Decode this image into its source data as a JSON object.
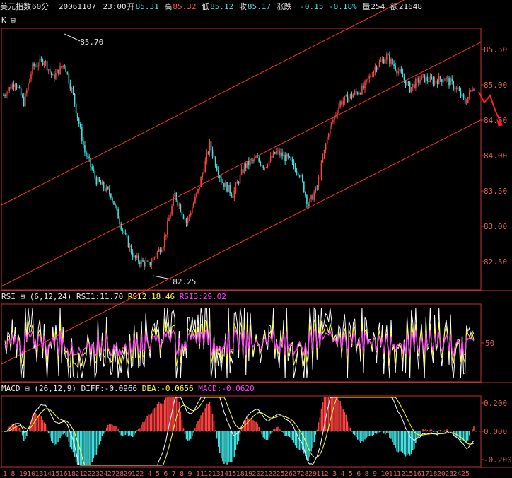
{
  "header": {
    "name": "美元指数",
    "period": "60分",
    "date": "20061107",
    "time": "23:00",
    "open_label": "开",
    "open": "85.31",
    "high_label": "高",
    "high": "85.32",
    "low_label": "低",
    "low": "85.12",
    "close_label": "收",
    "close": "85.17",
    "change_label": "涨跌",
    "change": "-0.15",
    "change_pct": "-0.18%",
    "vol_label": "量",
    "vol": "254",
    "amt_label": "额",
    "amt": "21648"
  },
  "kpanel": {
    "label": "K",
    "hi_label": "85.70",
    "lo_label": "82.25"
  },
  "rsi": {
    "label": "RSI",
    "params": "(6,12,24)",
    "rsi1": "RSI1:11.70",
    "rsi2": "RSI2:18.46",
    "rsi3": "RSI3:29.02"
  },
  "macd": {
    "label": "MACD",
    "params": "(26,12,9)",
    "diff": "DIFF:-0.0966",
    "dea": "DEA:-0.0656",
    "macd": "MACD:-0.0620"
  },
  "colors": {
    "up": "#ff4040",
    "down": "#40e0e0",
    "yellow": "#ffff40",
    "magenta": "#ff40ff",
    "frame": "#c03030"
  },
  "chart_data": [
    {
      "type": "candlestick",
      "yticks": [
        "85.50",
        "85.00",
        "84.50",
        "84.00",
        "83.50",
        "83.00",
        "82.50"
      ],
      "ylim": [
        82.1,
        85.8
      ],
      "annotations": [
        "85.70",
        "82.25"
      ],
      "anchors": [
        [
          0,
          84.85
        ],
        [
          8,
          85.05
        ],
        [
          14,
          84.75
        ],
        [
          20,
          85.25
        ],
        [
          28,
          85.35
        ],
        [
          34,
          85.1
        ],
        [
          42,
          85.3
        ],
        [
          48,
          84.85
        ],
        [
          56,
          84.05
        ],
        [
          64,
          83.65
        ],
        [
          74,
          83.45
        ],
        [
          82,
          82.95
        ],
        [
          90,
          82.55
        ],
        [
          100,
          82.45
        ],
        [
          110,
          82.75
        ],
        [
          118,
          83.45
        ],
        [
          126,
          83.05
        ],
        [
          134,
          83.5
        ],
        [
          142,
          84.15
        ],
        [
          150,
          83.65
        ],
        [
          158,
          83.45
        ],
        [
          166,
          83.85
        ],
        [
          174,
          83.95
        ],
        [
          180,
          83.85
        ],
        [
          188,
          84.05
        ],
        [
          196,
          83.95
        ],
        [
          204,
          83.75
        ],
        [
          210,
          83.3
        ],
        [
          216,
          83.55
        ],
        [
          224,
          84.35
        ],
        [
          232,
          84.75
        ],
        [
          240,
          84.85
        ],
        [
          248,
          84.95
        ],
        [
          256,
          85.25
        ],
        [
          264,
          85.4
        ],
        [
          272,
          85.2
        ],
        [
          280,
          84.95
        ],
        [
          288,
          85.1
        ],
        [
          296,
          85.05
        ],
        [
          304,
          85.1
        ],
        [
          312,
          84.95
        ],
        [
          318,
          84.75
        ],
        [
          324,
          85.0
        ]
      ],
      "candle_count": 325,
      "forecast_arrow": [
        [
          0,
          84.9
        ],
        [
          1,
          84.75
        ],
        [
          2,
          84.85
        ],
        [
          3,
          84.62
        ],
        [
          4,
          84.45
        ]
      ],
      "channel": {
        "slope_per_candle": 0.0105,
        "upper_at_0": 83.3,
        "mid_at_0": 82.15,
        "lower_at_0": 81.05
      }
    },
    {
      "type": "line",
      "series": [
        "RSI1",
        "RSI2",
        "RSI3"
      ],
      "yticks": [
        "50"
      ],
      "ylim": [
        0,
        100
      ]
    },
    {
      "type": "bar",
      "series": [
        "DIFF",
        "DEA",
        "MACD"
      ],
      "yticks": [
        "0.200",
        "0.000",
        "-0.200"
      ],
      "ylim": [
        -0.25,
        0.25
      ]
    }
  ],
  "xaxis": {
    "labels": [
      "1",
      "8",
      "19",
      "10",
      "13",
      "14",
      "15",
      "16",
      "18",
      "21",
      "22",
      "23",
      "24",
      "27",
      "28",
      "29",
      "12",
      "2",
      "4",
      "5",
      "6",
      "7",
      "8",
      "9",
      "11",
      "12",
      "13",
      "14",
      "15",
      "18",
      "19",
      "20",
      "21",
      "22",
      "25",
      "26",
      "27",
      "28",
      "29",
      "11",
      "2",
      "3",
      "4",
      "5",
      "6",
      "8",
      "9",
      "10",
      "11",
      "12",
      "15",
      "16",
      "17",
      "18",
      "20",
      "23",
      "24",
      "25"
    ]
  }
}
